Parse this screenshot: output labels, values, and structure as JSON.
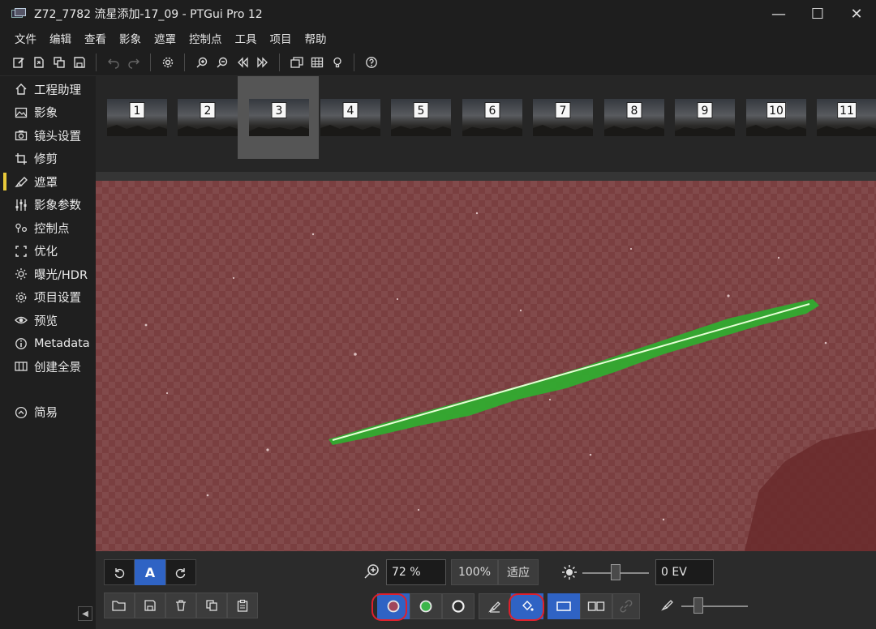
{
  "window": {
    "title": "Z72_7782 流星添加-17_09 - PTGui Pro 12",
    "minimize_glyph": "—",
    "maximize_glyph": "☐",
    "close_glyph": "✕"
  },
  "menu": [
    "文件",
    "编辑",
    "查看",
    "影象",
    "遮罩",
    "控制点",
    "工具",
    "项目",
    "帮助"
  ],
  "toolbar_icons": [
    "new-project-icon",
    "open-icon",
    "copy-icon",
    "save-icon",
    "undo-icon",
    "redo-icon",
    "settings-icon",
    "zoom-in-icon",
    "zoom-out-icon",
    "prev-image-icon",
    "next-image-icon",
    "panorama-editor-icon",
    "table-icon",
    "hint-icon",
    "help-icon"
  ],
  "sidebar": {
    "items": [
      {
        "label": "工程助理",
        "icon": "home-icon"
      },
      {
        "label": "影象",
        "icon": "image-icon"
      },
      {
        "label": "镜头设置",
        "icon": "camera-icon"
      },
      {
        "label": "修剪",
        "icon": "crop-icon"
      },
      {
        "label": "遮罩",
        "icon": "brush-icon",
        "active": true
      },
      {
        "label": "影象参数",
        "icon": "sliders-icon"
      },
      {
        "label": "控制点",
        "icon": "control-points-icon"
      },
      {
        "label": "优化",
        "icon": "optimize-icon"
      },
      {
        "label": "曝光/HDR",
        "icon": "sun-icon"
      },
      {
        "label": "项目设置",
        "icon": "gear-icon"
      },
      {
        "label": "预览",
        "icon": "eye-icon"
      },
      {
        "label": "Metadata",
        "icon": "info-icon"
      },
      {
        "label": "创建全景",
        "icon": "panorama-icon"
      }
    ],
    "simple_label": "简易",
    "collapse_glyph": "◀"
  },
  "thumbnails": {
    "numbers": [
      "1",
      "2",
      "3",
      "4",
      "5",
      "6",
      "7",
      "8",
      "9",
      "10",
      "11"
    ],
    "selected": "3"
  },
  "colors": {
    "mask_red": "#7a3f40",
    "mask_green": "#2fae2f",
    "accent_blue": "#2f63c4",
    "active_nav_bar": "#e8c93a",
    "annotation_red": "#e0202c"
  },
  "bottom": {
    "auto_label": "A",
    "zoom_value": "72 %",
    "zoom_100_label": "100%",
    "fit_label": "适应",
    "ev_value": "0 EV",
    "brightness_slider_fraction": 0.5,
    "brush_size_slider_fraction": 0.25
  }
}
